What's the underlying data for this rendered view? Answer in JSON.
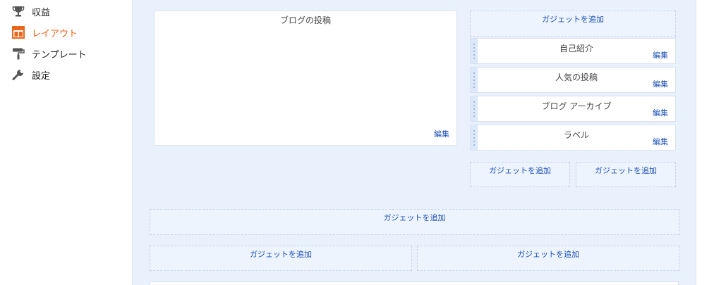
{
  "sidebar": {
    "items": [
      {
        "label": "収益",
        "icon": "trophy-icon",
        "active": false
      },
      {
        "label": "レイアウト",
        "icon": "layout-icon",
        "active": true
      },
      {
        "label": "テンプレート",
        "icon": "paint-roller-icon",
        "active": false
      },
      {
        "label": "設定",
        "icon": "wrench-icon",
        "active": false
      }
    ]
  },
  "layout": {
    "main_post": {
      "title": "ブログの投稿",
      "edit": "編集"
    },
    "add_gadget_label": "ガジェットを追加",
    "widgets": [
      {
        "title": "自己紹介",
        "edit": "編集"
      },
      {
        "title": "人気の投稿",
        "edit": "編集"
      },
      {
        "title": "ブログ アーカイブ",
        "edit": "編集"
      },
      {
        "title": "ラベル",
        "edit": "編集"
      }
    ]
  },
  "colors": {
    "accent": "#e8651a",
    "link": "#1a4fb4",
    "canvas": "#e9f1fd"
  }
}
